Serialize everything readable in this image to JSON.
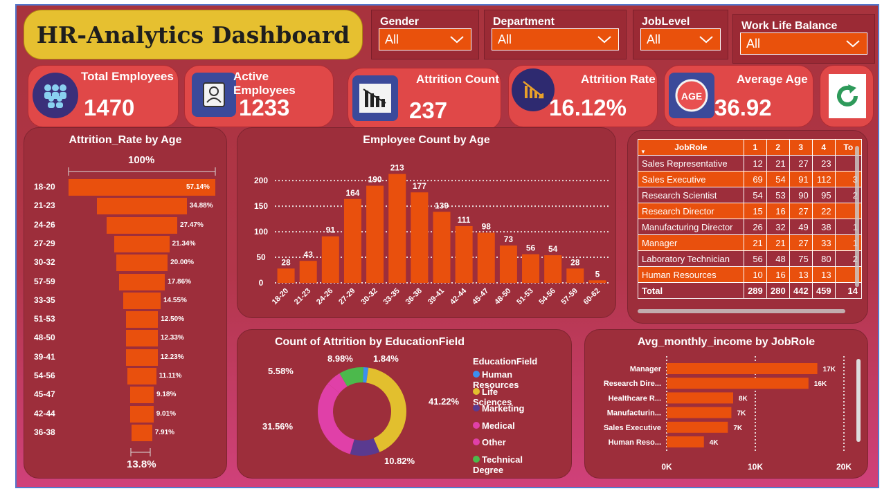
{
  "title": "HR-Analytics Dashboard",
  "filters": [
    {
      "label": "Gender",
      "value": "All"
    },
    {
      "label": "Department",
      "value": "All"
    },
    {
      "label": "JobLevel",
      "value": "All"
    },
    {
      "label": "Work Life Balance",
      "value": "All"
    }
  ],
  "kpis": {
    "total_employees": {
      "label": "Total Employees",
      "value": "1470",
      "icon": "people-group-icon"
    },
    "active_employees": {
      "label": "Active Employees",
      "value": "1233",
      "icon": "person-id-icon"
    },
    "attrition_count": {
      "label": "Attrition Count",
      "value": "237",
      "icon": "declining-bars-icon"
    },
    "attrition_rate": {
      "label": "Attrition Rate",
      "value": "16.12%",
      "icon": "trend-down-icon"
    },
    "average_age": {
      "label": "Average Age",
      "value": "36.92",
      "icon": "age-icon"
    }
  },
  "reset_icon": "refresh-icon",
  "chart_data": [
    {
      "type": "bar",
      "orientation": "funnel",
      "title": "Attrition_Rate by Age",
      "top_label": "100%",
      "bottom_label": "13.8%",
      "categories": [
        "18-20",
        "21-23",
        "24-26",
        "27-29",
        "30-32",
        "57-59",
        "33-35",
        "51-53",
        "48-50",
        "39-41",
        "54-56",
        "45-47",
        "42-44",
        "36-38"
      ],
      "values": [
        57.14,
        34.88,
        27.47,
        21.34,
        20.0,
        17.86,
        14.55,
        12.5,
        12.33,
        12.23,
        11.11,
        9.18,
        9.01,
        7.91
      ],
      "labels": [
        "57.14%",
        "34.88%",
        "27.47%",
        "21.34%",
        "20.00%",
        "17.86%",
        "14.55%",
        "12.50%",
        "12.33%",
        "12.23%",
        "11.11%",
        "9.18%",
        "9.01%",
        "7.91%"
      ]
    },
    {
      "type": "bar",
      "title": "Employee Count by Age",
      "categories": [
        "18-20",
        "21-23",
        "24-26",
        "27-29",
        "30-32",
        "33-35",
        "36-38",
        "39-41",
        "42-44",
        "45-47",
        "48-50",
        "51-53",
        "54-56",
        "57-59",
        "60-62"
      ],
      "values": [
        28,
        43,
        91,
        164,
        190,
        213,
        177,
        139,
        111,
        98,
        73,
        56,
        54,
        28,
        5
      ],
      "yticks": [
        "0",
        "50",
        "100",
        "150",
        "200"
      ],
      "ylim": [
        0,
        230
      ],
      "grid": true
    },
    {
      "type": "table",
      "headers": [
        "JobRole",
        "1",
        "2",
        "3",
        "4",
        "To"
      ],
      "rows": [
        [
          "Sales Representative",
          "12",
          "21",
          "27",
          "23",
          ""
        ],
        [
          "Sales Executive",
          "69",
          "54",
          "91",
          "112",
          "3"
        ],
        [
          "Research Scientist",
          "54",
          "53",
          "90",
          "95",
          "2"
        ],
        [
          "Research Director",
          "15",
          "16",
          "27",
          "22",
          ""
        ],
        [
          "Manufacturing Director",
          "26",
          "32",
          "49",
          "38",
          "1"
        ],
        [
          "Manager",
          "21",
          "21",
          "27",
          "33",
          "1"
        ],
        [
          "Laboratory Technician",
          "56",
          "48",
          "75",
          "80",
          "2"
        ],
        [
          "Human Resources",
          "10",
          "16",
          "13",
          "13",
          ""
        ]
      ],
      "total": [
        "Total",
        "289",
        "280",
        "442",
        "459",
        "14"
      ]
    },
    {
      "type": "pie",
      "title": "Count of Attrition by EducationField",
      "legend_title": "EducationField",
      "slices": [
        {
          "name": "Human Resources",
          "value": 1.84,
          "label": "1.84%",
          "color": "#3b8ff0"
        },
        {
          "name": "Life Sciences",
          "value": 41.22,
          "label": "41.22%",
          "color": "#e2bf2e"
        },
        {
          "name": "Marketing",
          "value": 10.82,
          "label": "10.82%",
          "color": "#5a3a90"
        },
        {
          "name": "Medical",
          "value": 31.56,
          "label": "31.56%",
          "color": "#e040a8"
        },
        {
          "name": "Other",
          "value": 5.58,
          "label": "5.58%",
          "color": "#e040a8"
        },
        {
          "name": "Technical Degree",
          "value": 8.98,
          "label": "8.98%",
          "color": "#4cb94c"
        }
      ]
    },
    {
      "type": "bar",
      "orientation": "horizontal",
      "title": "Avg_monthly_income by JobRole",
      "categories": [
        "Manager",
        "Research Dire...",
        "Healthcare R...",
        "Manufacturin...",
        "Sales Executive",
        "Human Reso..."
      ],
      "values": [
        17000,
        16000,
        7500,
        7300,
        6900,
        4200
      ],
      "labels": [
        "17K",
        "16K",
        "8K",
        "7K",
        "7K",
        "4K"
      ],
      "xticks": [
        "0K",
        "10K",
        "20K"
      ],
      "xlim": [
        0,
        20000
      ]
    }
  ]
}
